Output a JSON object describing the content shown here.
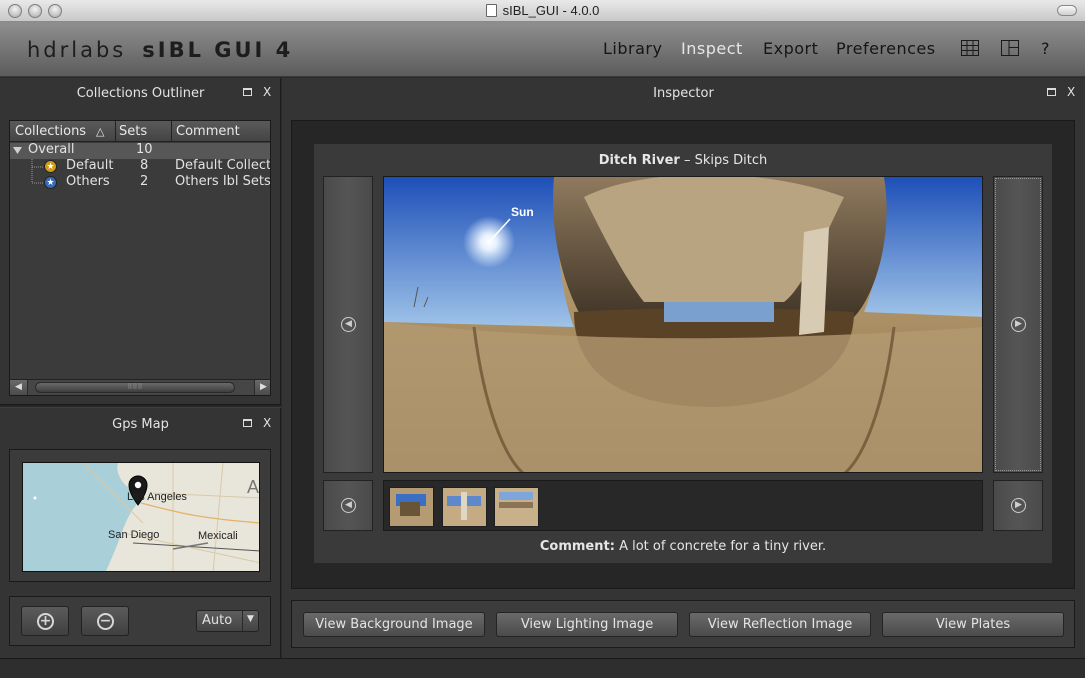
{
  "window": {
    "title": "sIBL_GUI - 4.0.0"
  },
  "header": {
    "brand_left": "hdrlabs",
    "brand_right": "sIBL GUI 4",
    "nav": [
      "Library",
      "Inspect",
      "Export",
      "Preferences"
    ],
    "active_nav": "Inspect",
    "help_label": "?"
  },
  "collections_outliner": {
    "title": "Collections Outliner",
    "columns": [
      "Collections",
      "Sets",
      "Comment"
    ],
    "sort_indicator": "△",
    "rows": [
      {
        "name": "Overall",
        "sets": "10",
        "comment": ""
      },
      {
        "name": "Default",
        "sets": "8",
        "comment": "Default Collect"
      },
      {
        "name": "Others",
        "sets": "2",
        "comment": "Others Ibl Sets"
      }
    ]
  },
  "gps_map": {
    "title": "Gps Map",
    "labels": [
      "Los Angeles",
      "San Diego",
      "Mexicali",
      "A"
    ]
  },
  "left_controls": {
    "zoom_in": "+",
    "zoom_out": "−",
    "combo_value": "Auto"
  },
  "inspector": {
    "title": "Inspector",
    "set_name": "Ditch River",
    "set_title": "Skips Ditch",
    "separator": "–",
    "sun_label": "Sun",
    "comment_label": "Comment:",
    "comment": "A lot of concrete for a tiny river.",
    "buttons": [
      "View Background Image",
      "View Lighting Image",
      "View Reflection Image",
      "View Plates"
    ]
  },
  "panel_controls": {
    "close": "X"
  },
  "colors": {
    "active_nav": "#e6e6e6",
    "sky": "#2f63c4",
    "sand": "#b49768"
  }
}
